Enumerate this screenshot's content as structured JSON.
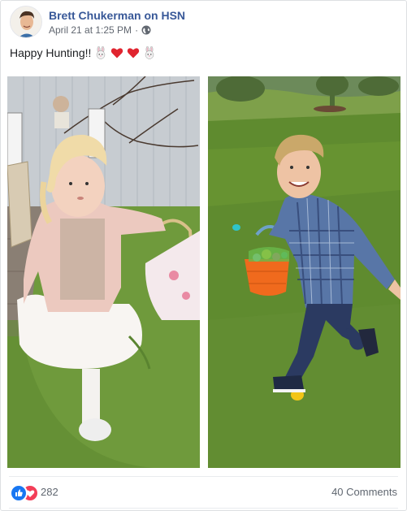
{
  "post": {
    "author": "Brett Chukerman on HSN",
    "timestamp": "April 21 at 1:25 PM",
    "separator": "·",
    "audience_icon": "globe-icon",
    "text": "Happy Hunting!!",
    "text_emojis": [
      "bunny-emoji",
      "red-heart-emoji",
      "red-heart-emoji",
      "bunny-emoji"
    ]
  },
  "photos": [
    {
      "name": "photo-girl-with-basket"
    },
    {
      "name": "photo-boy-with-basket"
    }
  ],
  "footer": {
    "reaction_icons": [
      "like-icon",
      "love-icon"
    ],
    "reaction_count": "282",
    "comments_label": "40 Comments"
  },
  "colors": {
    "link_blue": "#385898",
    "like_blue": "#1877f2",
    "love_red": "#f33e58",
    "meta_gray": "#616770"
  }
}
